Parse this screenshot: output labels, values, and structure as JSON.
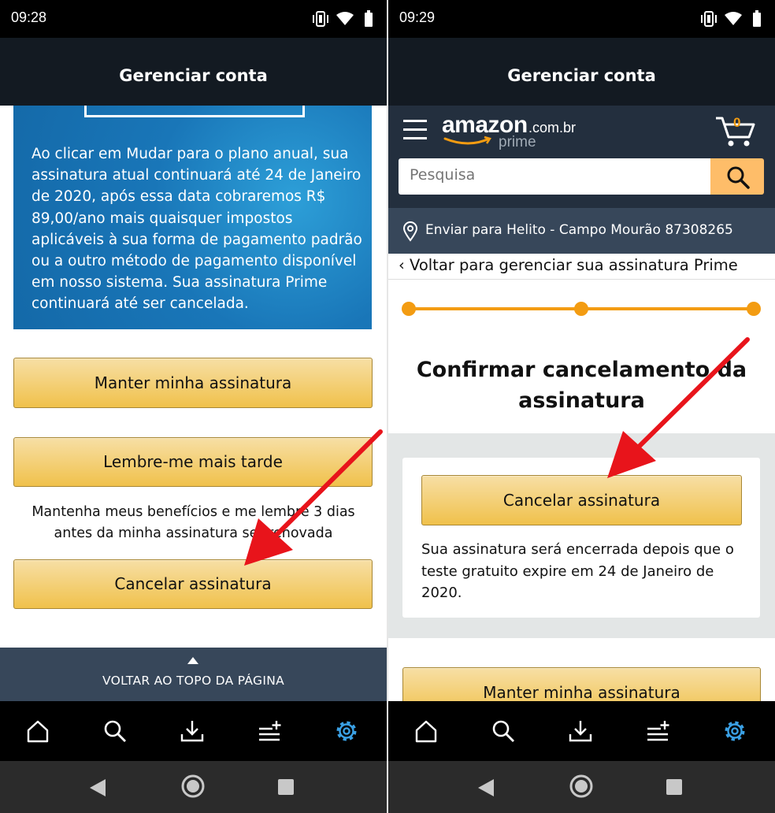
{
  "left": {
    "status_time": "09:28",
    "title": "Gerenciar conta",
    "info_text": "Ao clicar em Mudar para o plano anual, sua assinatura atual continuará até 24 de Janeiro de 2020, após essa data cobraremos R$ 89,00/ano mais quaisquer impostos aplicáveis à sua forma de pagamento padrão ou a outro método de pagamento disponível em nosso sistema. Sua assinatura Prime continuará até ser cancelada.",
    "keep_button": "Manter minha assinatura",
    "remind_button": "Lembre-me mais tarde",
    "remind_note": "Mantenha meus benefícios e me lembre 3 dias antes da minha assinatura ser renovada",
    "cancel_button": "Cancelar assinatura",
    "back_to_top": "VOLTAR AO TOPO DA PÁGINA"
  },
  "right": {
    "status_time": "09:29",
    "title": "Gerenciar conta",
    "logo_text": "amazon",
    "logo_domain": ".com.br",
    "logo_prime": "prime",
    "cart_count": "0",
    "search_placeholder": "Pesquisa",
    "ship_to": "Enviar para Helito - Campo Mourão 87308265",
    "breadcrumb": "‹ Voltar para gerenciar sua assinatura Prime",
    "heading": "Confirmar cancelamento da assinatura",
    "cancel_button": "Cancelar assinatura",
    "cancel_note": "Sua assinatura será encerrada depois que o teste gratuito expire em 24 de Janeiro de 2020.",
    "keep_button": "Manter minha assinatura"
  },
  "bottom_nav_icons": [
    "home-icon",
    "search-icon",
    "download-icon",
    "playlist-add-icon",
    "settings-icon"
  ],
  "android_nav_icons": [
    "back-icon",
    "home-circle-icon",
    "recents-icon"
  ],
  "colors": {
    "topbar": "#131a22",
    "amazon_header": "#232f3e",
    "info_blue": "#1976b8",
    "button_yellow": "#f0c14b",
    "search_orange": "#febd69",
    "step_orange": "#f39c12",
    "arrow_red": "#e8141b",
    "settings_active": "#3aa0e4"
  }
}
